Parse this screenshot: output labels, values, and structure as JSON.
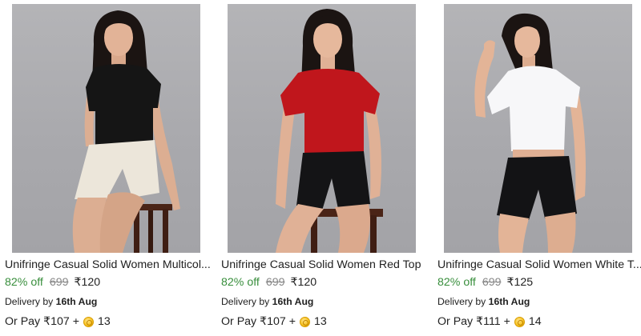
{
  "products": [
    {
      "title": "Unifringe Casual Solid Women Multicol...",
      "discount": "82% off",
      "mrp": "699",
      "price": "₹120",
      "delivery_prefix": "Delivery by ",
      "delivery_date": "16th Aug",
      "pay_text": "Or Pay ₹107 +",
      "coins": "13",
      "top_color": "#151515",
      "bottom_color": "#ece6da",
      "image": "woman-black-top-white-shorts"
    },
    {
      "title": "Unifringe Casual Solid Women Red Top",
      "discount": "82% off",
      "mrp": "699",
      "price": "₹120",
      "delivery_prefix": "Delivery by ",
      "delivery_date": "16th Aug",
      "pay_text": "Or Pay ₹107 +",
      "coins": "13",
      "top_color": "#c0161c",
      "bottom_color": "#141416",
      "image": "woman-red-top-black-shorts"
    },
    {
      "title": "Unifringe Casual Solid Women White T...",
      "discount": "82% off",
      "mrp": "699",
      "price": "₹125",
      "delivery_prefix": "Delivery by ",
      "delivery_date": "16th Aug",
      "pay_text": "Or Pay ₹111 +",
      "coins": "14",
      "top_color": "#f7f7f9",
      "bottom_color": "#131315",
      "image": "woman-white-top-black-shorts"
    }
  ],
  "colors": {
    "discount_green": "#388e3c",
    "mrp_grey": "#878787",
    "studio_bg": "#aeaeb2",
    "coin_gold": "#f7c325"
  }
}
